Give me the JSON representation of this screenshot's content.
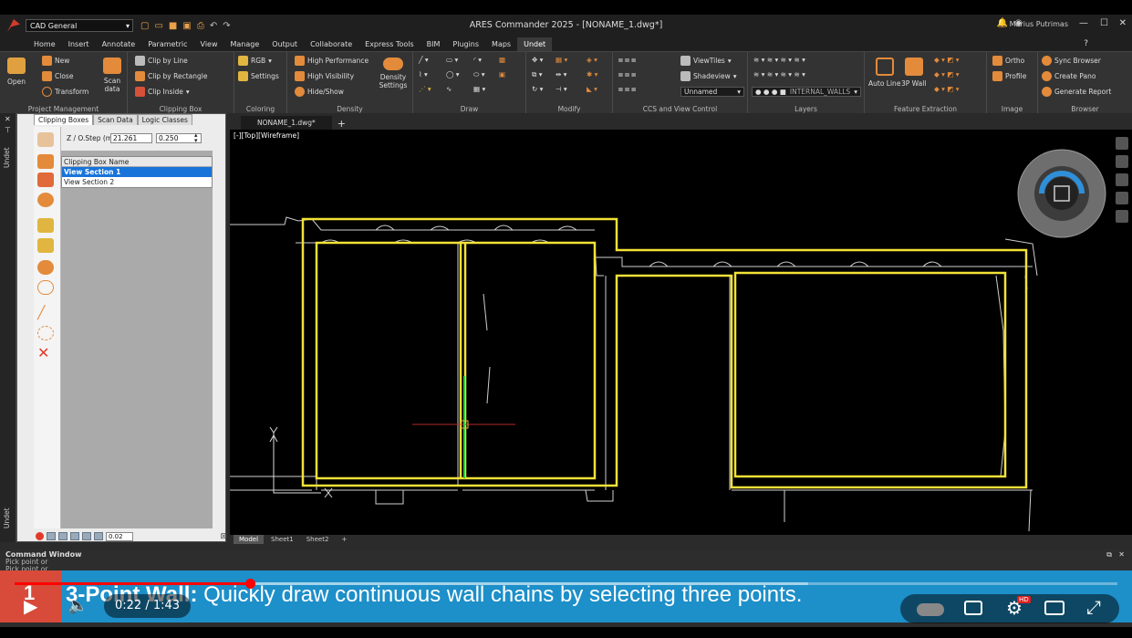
{
  "titlebar": {
    "workspace": "CAD General",
    "window_title": "ARES Commander 2025 - [NONAME_1.dwg*]",
    "user": "Marius Putrimas"
  },
  "menu": {
    "tabs": [
      "Home",
      "Insert",
      "Annotate",
      "Parametric",
      "View",
      "Manage",
      "Output",
      "Collaborate",
      "Express Tools",
      "BIM",
      "Plugins",
      "Maps",
      "Undet"
    ],
    "active": "Undet",
    "help": "?"
  },
  "ribbon": {
    "project_management": {
      "title": "Project Management",
      "open": "Open",
      "new": "New",
      "close": "Close",
      "transform": "Transform",
      "scan_data": "Scan data"
    },
    "clipping_box": {
      "title": "Clipping Box",
      "clip_by_line": "Clip by Line",
      "clip_by_rectangle": "Clip by Rectangle",
      "clip_inside": "Clip Inside"
    },
    "coloring": {
      "title": "Coloring",
      "rgb": "RGB",
      "settings": "Settings"
    },
    "density": {
      "title": "Density",
      "high_performance": "High Performance",
      "high_visibility": "High Visibility",
      "hide_show": "Hide/Show",
      "density_settings": "Density Settings"
    },
    "draw": {
      "title": "Draw"
    },
    "modify": {
      "title": "Modify"
    },
    "ccs": {
      "title": "CCS and View Control",
      "viewtiles": "ViewTiles",
      "shadeview": "Shadeview",
      "unnamed": "Unnamed"
    },
    "layers": {
      "title": "Layers",
      "layer_name": "INTERNAL_WALLS"
    },
    "feature_extraction": {
      "title": "Feature Extraction",
      "auto_line": "Auto Line",
      "wall_3p": "3P Wall"
    },
    "image": {
      "title": "Image",
      "ortho": "Ortho",
      "profile": "Profile"
    },
    "browser": {
      "title": "Browser",
      "sync_browser": "Sync Browser",
      "create_pano": "Create Pano",
      "generate_report": "Generate Report"
    }
  },
  "side_strip": {
    "top_label": "Undet",
    "bottom_label": "Undet"
  },
  "panel": {
    "tabs": [
      "Clipping Boxes",
      "Scan Data",
      "Logic Classes"
    ],
    "active_tab": "Clipping Boxes",
    "z_label": "Z / O.Step (m)",
    "z_value": "21.261",
    "step_value": "0.250",
    "table_header": "Clipping Box Name",
    "rows": [
      {
        "name": "View Section 1",
        "selected": true
      },
      {
        "name": "View Section 2",
        "selected": false
      }
    ],
    "bottom_value": "0.02"
  },
  "document": {
    "tab": "NONAME_1.dwg*",
    "viewport_label": "[-][Top][Wireframe]",
    "layout_tabs": [
      "Model",
      "Sheet1",
      "Sheet2"
    ],
    "active_layout": "Model"
  },
  "command_window": {
    "title": "Command Window",
    "lines": [
      "Pick point or",
      "Pick point or..."
    ]
  },
  "video": {
    "chapter_number": "1",
    "caption_bold": "3-Point Wall:",
    "caption_text": " Quickly draw continuous wall chains by selecting three points.",
    "current_time": "0:22",
    "duration": "1:43",
    "time_display": "0:22 / 1:43",
    "progress": 0.213,
    "buffered": 0.72,
    "hd_badge": "HD"
  },
  "colors": {
    "wall_outline": "#f2e236",
    "ui_accent": "#e38b3b",
    "caption_bar": "#1d8fc9",
    "chapter_badge": "#d84a3a",
    "progress": "#ff0000",
    "selection": "#1874d9"
  }
}
